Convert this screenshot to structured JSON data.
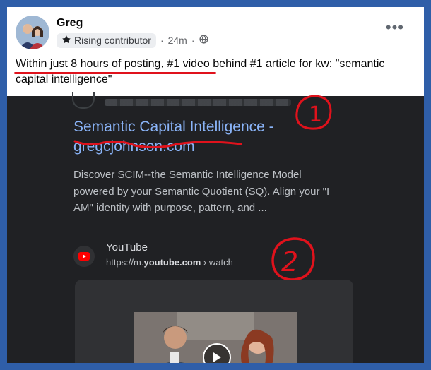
{
  "post": {
    "author": "Greg",
    "badge_label": "Rising contributor",
    "time": "24m",
    "separator": "·",
    "more_label": "•••",
    "text": "Within just 8 hours of posting, #1 video behind #1 article for kw: \"semantic capital intelligence\""
  },
  "result": {
    "title": "Semantic Capital Intelligence - gregcjohnson.com",
    "snippet": "Discover SCIM--the Semantic Intelligence Model powered by your Semantic Quotient (SQ). Align your \"I AM\" identity with purpose, pattern, and ..."
  },
  "video": {
    "source_name": "YouTube",
    "url_prefix": "https://m.",
    "url_domain": "youtube.com",
    "url_suffix": " › watch"
  },
  "annotations": {
    "marker_1": "1",
    "marker_2": "2"
  },
  "colors": {
    "frame_border": "#2f5ea8",
    "annotation_red": "#e0121c",
    "link_blue": "#8ab4f8",
    "youtube_red": "#ff0000"
  },
  "icons": [
    "star-icon",
    "globe-icon",
    "more-options-icon",
    "youtube-icon",
    "play-icon"
  ]
}
